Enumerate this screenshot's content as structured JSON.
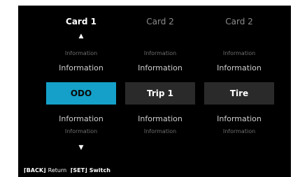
{
  "cards": [
    {
      "title": "Card 1",
      "info_top_small": "Information",
      "info_top_large": "Information",
      "tile_label": "ODO",
      "info_bottom_large": "Information",
      "info_bottom_small": "Information"
    },
    {
      "title": "Card 2",
      "info_top_small": "Information",
      "info_top_large": "Information",
      "tile_label": "Trip 1",
      "info_bottom_large": "Information",
      "info_bottom_small": "Information"
    },
    {
      "title": "Card 2",
      "info_top_small": "Information",
      "info_top_large": "Information",
      "tile_label": "Tire",
      "info_bottom_large": "Information",
      "info_bottom_small": "Information"
    }
  ],
  "arrows": {
    "up": "▲",
    "down": "▼"
  },
  "footer": {
    "back_key": "⌈BACK⌋",
    "back_label": "Return",
    "set_key": "⌈SET⌋",
    "set_label": "Switch"
  },
  "colors": {
    "screen_bg": "#000000",
    "selected_tile": "#14a0c8",
    "tile": "#2a2a2a"
  },
  "selected_card_index": 0
}
